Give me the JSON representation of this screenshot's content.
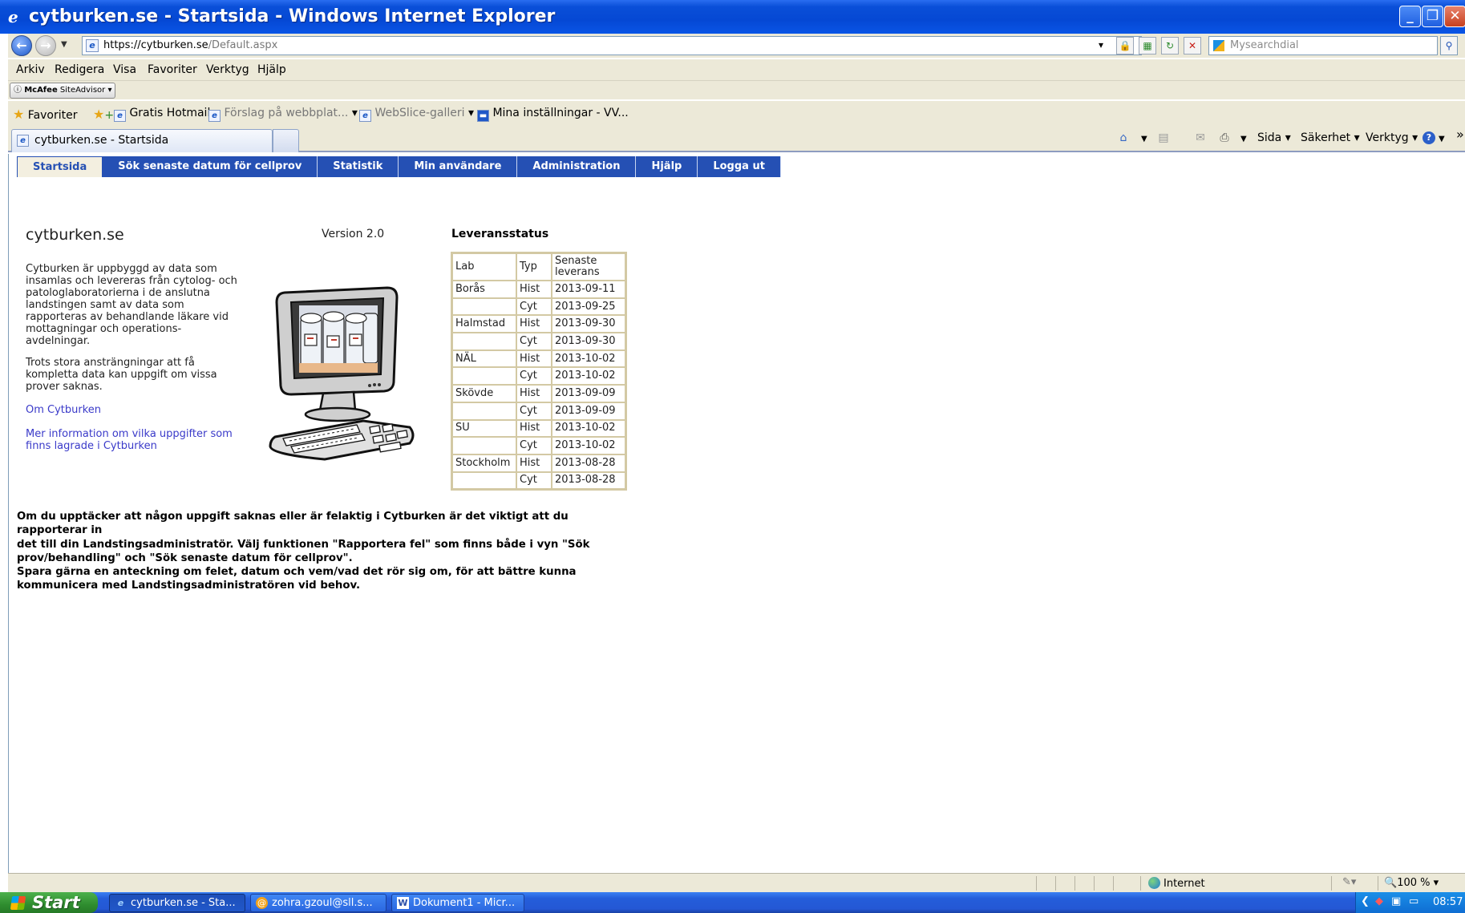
{
  "window": {
    "title": "cytburken.se - Startsida - Windows Internet Explorer",
    "controls": [
      "_",
      "❐",
      "✕"
    ]
  },
  "address": {
    "protocol": "https://",
    "host": "cytburken.se",
    "path": "/Default.aspx",
    "search_placeholder": "Mysearchdial"
  },
  "menu": [
    "Arkiv",
    "Redigera",
    "Visa",
    "Favoriter",
    "Verktyg",
    "Hjälp"
  ],
  "mcafee": {
    "brand": "McAfee",
    "product": "SiteAdvisor"
  },
  "favorites": {
    "label": "Favoriter",
    "items": [
      "Gratis Hotmail",
      "Förslag på webbplat...",
      "WebSlice-galleri",
      "Mina inställningar - VV..."
    ]
  },
  "tab": {
    "title": "cytburken.se - Startsida"
  },
  "commands": {
    "page": "Sida",
    "safety": "Säkerhet",
    "tools": "Verktyg",
    "more": "»"
  },
  "site": {
    "nav": [
      "Startsida",
      "Sök senaste datum för cellprov",
      "Statistik",
      "Min användare",
      "Administration",
      "Hjälp",
      "Logga ut"
    ],
    "active_nav": "Startsida",
    "title": "cytburken.se",
    "version": "Version 2.0",
    "intro_lines": [
      "Cytburken är uppbyggd av data som",
      "insamlas och levereras från cytolog- och",
      "patologlaboratorierna i de anslutna",
      "landstingen samt av data som",
      "rapporteras av behandlande läkare vid",
      "mottagningar och operations-",
      "avdelningar."
    ],
    "note_lines": [
      "Trots stora ansträngningar att få",
      "kompletta data kan uppgift om vissa",
      "prover saknas."
    ],
    "link_about": "Om Cytburken",
    "link_more_lines": [
      "Mer information om vilka uppgifter som",
      "finns lagrade i Cytburken"
    ],
    "delivery": {
      "title": "Leveransstatus",
      "headers": {
        "lab": "Lab",
        "type": "Typ",
        "latest_line1": "Senaste",
        "latest_line2": "leverans"
      },
      "rows": [
        {
          "lab": "Borås",
          "type": "Hist",
          "date": "2013-09-11"
        },
        {
          "lab": "",
          "type": "Cyt",
          "date": "2013-09-25"
        },
        {
          "lab": "Halmstad",
          "type": "Hist",
          "date": "2013-09-30"
        },
        {
          "lab": "",
          "type": "Cyt",
          "date": "2013-09-30"
        },
        {
          "lab": "NÄL",
          "type": "Hist",
          "date": "2013-10-02"
        },
        {
          "lab": "",
          "type": "Cyt",
          "date": "2013-10-02"
        },
        {
          "lab": "Skövde",
          "type": "Hist",
          "date": "2013-09-09"
        },
        {
          "lab": "",
          "type": "Cyt",
          "date": "2013-09-09"
        },
        {
          "lab": "SU",
          "type": "Hist",
          "date": "2013-10-02"
        },
        {
          "lab": "",
          "type": "Cyt",
          "date": "2013-10-02"
        },
        {
          "lab": "Stockholm",
          "type": "Hist",
          "date": "2013-08-28"
        },
        {
          "lab": "",
          "type": "Cyt",
          "date": "2013-08-28"
        }
      ]
    },
    "footer_lines": [
      "Om du upptäcker att någon uppgift saknas eller är felaktig i Cytburken är det viktigt att du rapporterar in",
      "det till din Landstingsadministratör. Välj funktionen \"Rapportera fel\" som finns både i vyn \"Sök",
      "prov/behandling\" och \"Sök senaste datum för cellprov\".",
      "Spara gärna en anteckning om felet, datum och vem/vad det rör sig om, för att bättre kunna",
      "kommunicera med Landstingsadministratören vid behov."
    ]
  },
  "status": {
    "zone": "Internet",
    "zoom": "100 %"
  },
  "taskbar": {
    "start": "Start",
    "items": [
      "cytburken.se - Sta...",
      "zohra.gzoul@sll.s...",
      "Dokument1 - Micr..."
    ],
    "clock": "08:57"
  },
  "colors": {
    "nav_blue": "#2550b4",
    "xp_blue": "#0548d4",
    "link": "#3a3ac9",
    "table_border": "#d3c9a4"
  }
}
